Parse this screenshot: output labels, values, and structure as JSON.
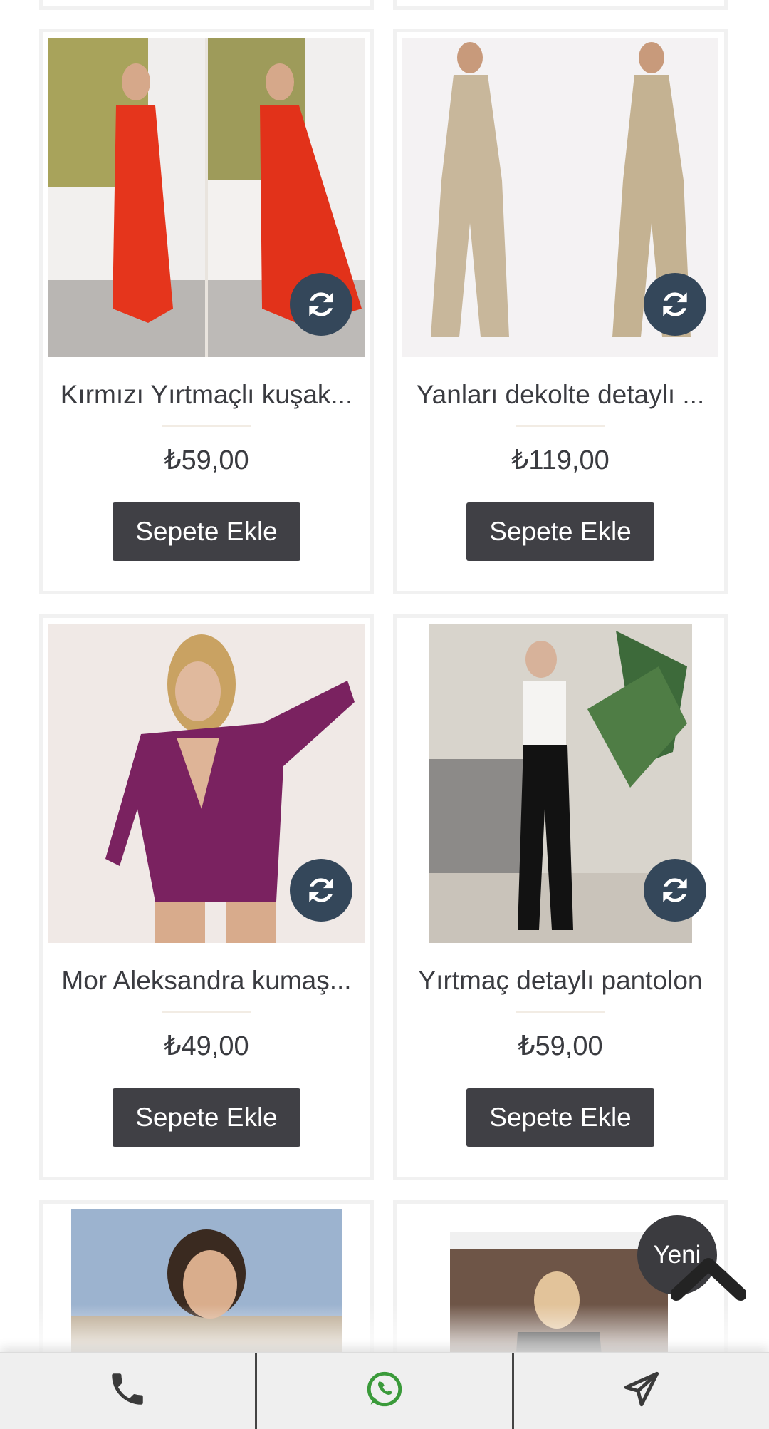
{
  "products": [
    {
      "title": "Kırmızı Yırtmaçlı kuşak...",
      "price": "₺59,00",
      "button": "Sepete Ekle",
      "image": "red-dress-photo"
    },
    {
      "title": "Yanları dekolte detaylı ...",
      "price": "₺119,00",
      "button": "Sepete Ekle",
      "image": "gold-jumpsuit-photo"
    },
    {
      "title": "Mor Aleksandra kumaş...",
      "price": "₺49,00",
      "button": "Sepete Ekle",
      "image": "purple-romper-photo"
    },
    {
      "title": "Yırtmaç detaylı pantolon",
      "price": "₺59,00",
      "button": "Sepete Ekle",
      "image": "black-pants-photo"
    }
  ],
  "badge": {
    "label": "Yeni"
  },
  "bottom_bar": {
    "icons": [
      "phone-icon",
      "whatsapp-icon",
      "send-icon"
    ]
  },
  "colors": {
    "button": "#404045",
    "refresh": "#34475a",
    "whatsapp": "#3a9a3a"
  }
}
